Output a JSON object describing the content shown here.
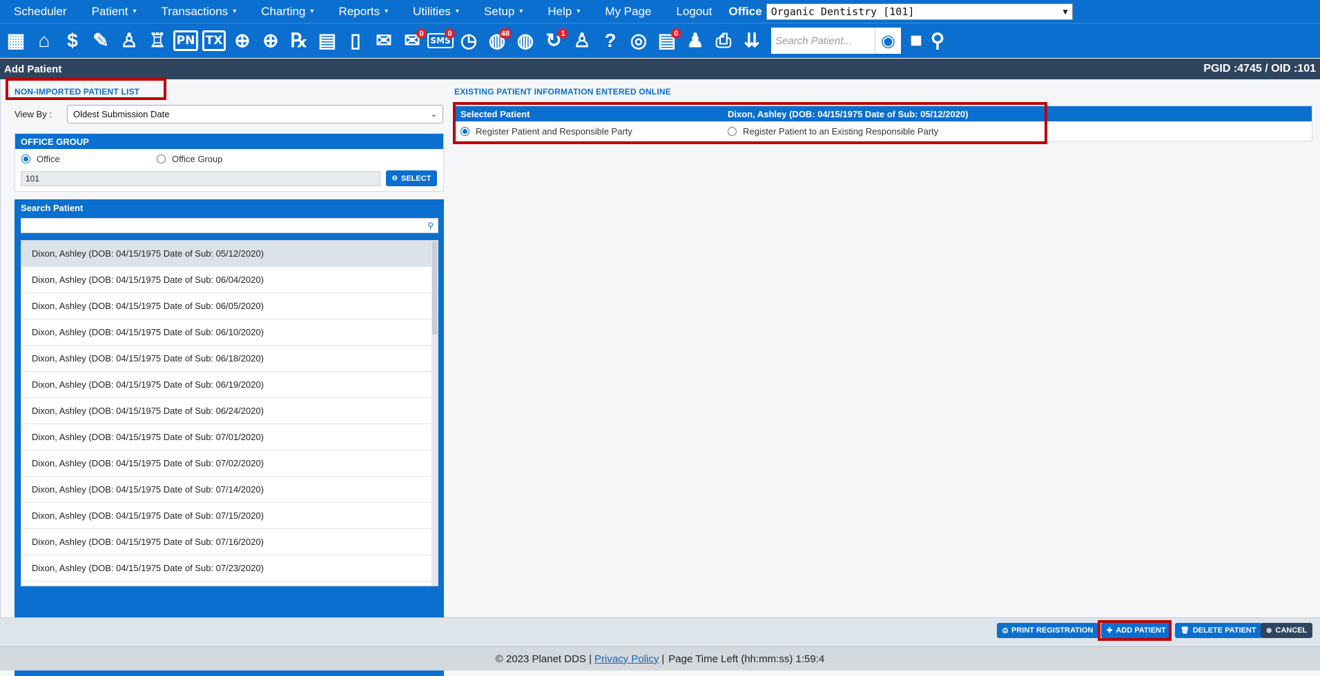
{
  "menu": {
    "items": [
      {
        "label": "Scheduler",
        "caret": false
      },
      {
        "label": "Patient",
        "caret": true
      },
      {
        "label": "Transactions",
        "caret": true
      },
      {
        "label": "Charting",
        "caret": true
      },
      {
        "label": "Reports",
        "caret": true
      },
      {
        "label": "Utilities",
        "caret": true
      },
      {
        "label": "Setup",
        "caret": true
      },
      {
        "label": "Help",
        "caret": true
      },
      {
        "label": "My Page",
        "caret": false
      },
      {
        "label": "Logout",
        "caret": false
      }
    ],
    "caret_glyph": "▾",
    "office_label": "Office",
    "office_value": "Organic Dentistry [101]"
  },
  "toolbar": {
    "icons": [
      {
        "name": "calendar-icon",
        "glyph": "▦"
      },
      {
        "name": "home-icon",
        "glyph": "⌂"
      },
      {
        "name": "ledger-icon",
        "glyph": "$"
      },
      {
        "name": "edit-icon",
        "glyph": "✎"
      },
      {
        "name": "tooth-chart-icon",
        "glyph": "♙"
      },
      {
        "name": "perio-icon",
        "glyph": "♖"
      },
      {
        "name": "progress-notes-icon",
        "text": "PN"
      },
      {
        "name": "treatment-icon",
        "text": "TX"
      },
      {
        "name": "add-patient-icon",
        "glyph": "⊕"
      },
      {
        "name": "add-family-icon",
        "glyph": "⊕"
      },
      {
        "name": "prescription-icon",
        "glyph": "℞"
      },
      {
        "name": "notes-icon",
        "glyph": "▤"
      },
      {
        "name": "document-icon",
        "glyph": "▯"
      },
      {
        "name": "mail-icon",
        "glyph": "✉"
      },
      {
        "name": "messages-icon",
        "glyph": "✉",
        "badge": "0"
      },
      {
        "name": "sms-icon",
        "text": "SMS",
        "badge": "0"
      },
      {
        "name": "clock-icon",
        "glyph": "◷"
      },
      {
        "name": "online-patients-icon",
        "glyph": "◍",
        "badge": "48"
      },
      {
        "name": "globe-user-icon",
        "glyph": "◍"
      },
      {
        "name": "sync-icon",
        "glyph": "↻",
        "badge": "1"
      },
      {
        "name": "tooth-icon",
        "glyph": "♙"
      },
      {
        "name": "tooth-question-icon",
        "glyph": "?"
      },
      {
        "name": "web-icon",
        "glyph": "◎"
      },
      {
        "name": "forms-icon",
        "glyph": "▤",
        "badge": "0"
      },
      {
        "name": "group-icon",
        "glyph": "♟"
      },
      {
        "name": "print-icon",
        "glyph": "⎙"
      },
      {
        "name": "expand-icon",
        "glyph": "⇊"
      }
    ],
    "search_placeholder": "Search Patient...",
    "search_icon": "user-search-icon",
    "search_glyph": "◉",
    "group_search_glyph": "⚲"
  },
  "header": {
    "title": "Add Patient",
    "ids": "PGID :4745  /  OID :101"
  },
  "left": {
    "section_title": "NON-IMPORTED PATIENT LIST",
    "view_by_label": "View By :",
    "view_by_value": "Oldest Submission Date",
    "office_group": {
      "title": "OFFICE GROUP",
      "radio_office": "Office",
      "radio_group": "Office Group",
      "selected": "Office",
      "office_value": "101",
      "select_button": "SELECT"
    },
    "search": {
      "title": "Search Patient",
      "value": ""
    },
    "patients": [
      "Dixon, Ashley (DOB: 04/15/1975 Date of Sub: 05/12/2020)",
      "Dixon, Ashley (DOB: 04/15/1975 Date of Sub: 06/04/2020)",
      "Dixon, Ashley (DOB: 04/15/1975 Date of Sub: 06/05/2020)",
      "Dixon, Ashley (DOB: 04/15/1975 Date of Sub: 06/10/2020)",
      "Dixon, Ashley (DOB: 04/15/1975 Date of Sub: 06/18/2020)",
      "Dixon, Ashley (DOB: 04/15/1975 Date of Sub: 06/19/2020)",
      "Dixon, Ashley (DOB: 04/15/1975 Date of Sub: 06/24/2020)",
      "Dixon, Ashley (DOB: 04/15/1975 Date of Sub: 07/01/2020)",
      "Dixon, Ashley (DOB: 04/15/1975 Date of Sub: 07/02/2020)",
      "Dixon, Ashley (DOB: 04/15/1975 Date of Sub: 07/14/2020)",
      "Dixon, Ashley (DOB: 04/15/1975 Date of Sub: 07/15/2020)",
      "Dixon, Ashley (DOB: 04/15/1975 Date of Sub: 07/16/2020)",
      "Dixon, Ashley (DOB: 04/15/1975 Date of Sub: 07/23/2020)"
    ],
    "selected_index": 0
  },
  "right": {
    "section_title": "EXISTING PATIENT INFORMATION ENTERED ONLINE",
    "selected_label": "Selected Patient",
    "selected_value": "Dixon, Ashley (DOB: 04/15/1975 Date of Sub: 05/12/2020)",
    "option_register_both": "Register Patient and Responsible Party",
    "option_register_existing": "Register Patient to an Existing Responsible Party",
    "selected_option": "Register Patient and Responsible Party"
  },
  "actions": {
    "print_registration": "PRINT REGISTRATION",
    "add_patient": "ADD PATIENT",
    "delete_patient": "DELETE PATIENT",
    "cancel": "CANCEL"
  },
  "footer": {
    "copyright": "© 2023 Planet DDS |",
    "privacy_link": "Privacy Policy",
    "separator": "|",
    "time_left": "Page Time Left (hh:mm:ss) 1:59:4"
  },
  "colors": {
    "primary": "#0a6fcf",
    "header_bar": "#2f455f",
    "highlight_red": "#c00000",
    "badge_red": "#d9232d",
    "cancel_button": "#2f455f"
  }
}
